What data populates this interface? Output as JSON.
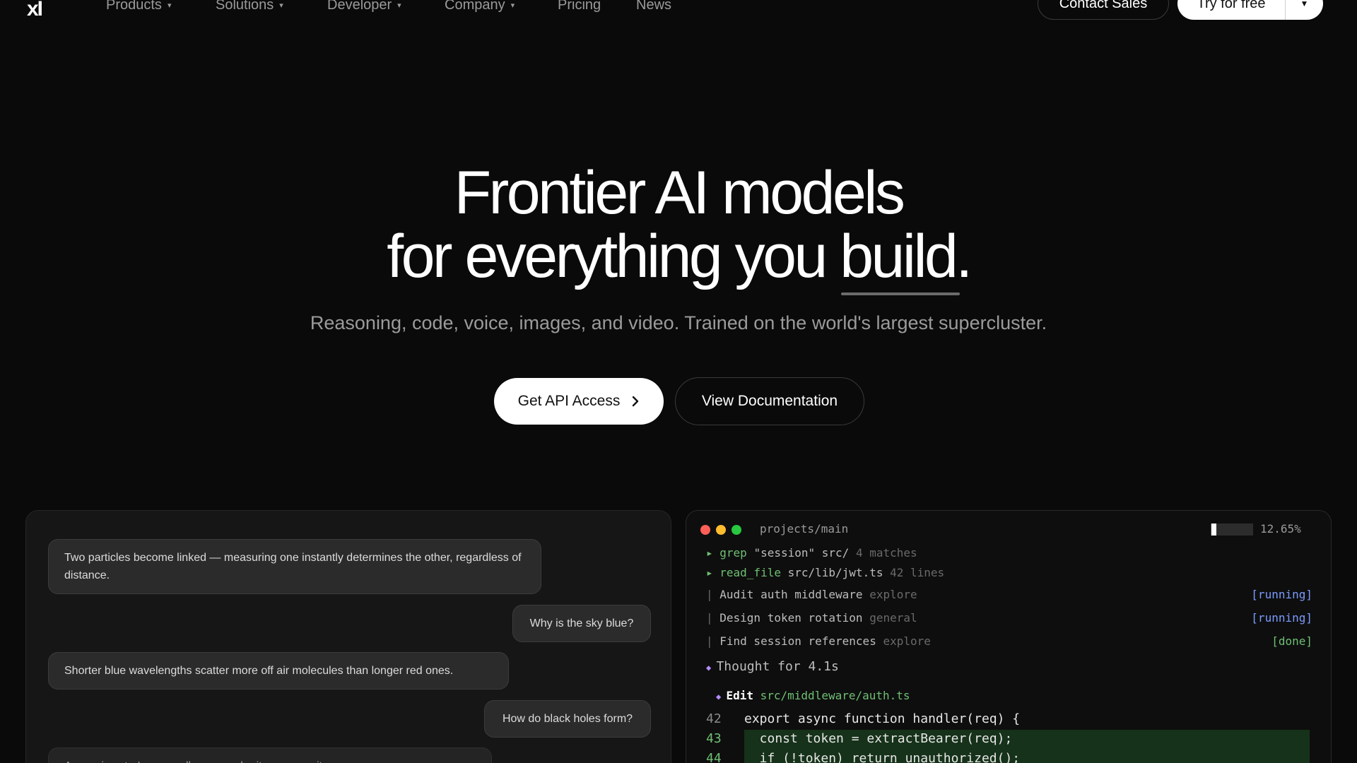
{
  "nav": {
    "logo": "xI",
    "items": [
      {
        "label": "Products",
        "has_dropdown": true
      },
      {
        "label": "Solutions",
        "has_dropdown": true
      },
      {
        "label": "Developer",
        "has_dropdown": true
      },
      {
        "label": "Company",
        "has_dropdown": true
      },
      {
        "label": "Pricing",
        "has_dropdown": false
      },
      {
        "label": "News",
        "has_dropdown": false
      }
    ],
    "contact_label": "Contact Sales",
    "try_label": "Try for free"
  },
  "hero": {
    "title_line1": "Frontier AI models",
    "title_line2_prefix": "for everything you ",
    "title_highlight": "build",
    "title_suffix": ".",
    "subtitle": "Reasoning, code, voice, images, and video. Trained on the world's largest supercluster.",
    "cta_primary": "Get API Access",
    "cta_secondary": "View Documentation"
  },
  "chat": {
    "messages": [
      {
        "role": "assistant",
        "text": "Two particles become linked — measuring one instantly determines the other, regardless of distance."
      },
      {
        "role": "user",
        "text": "Why is the sky blue?"
      },
      {
        "role": "assistant",
        "text": "Shorter blue wavelengths scatter more off air molecules than longer red ones."
      },
      {
        "role": "user",
        "text": "How do black holes form?"
      },
      {
        "role": "assistant",
        "text": "A massive star's core collapses under its own gravity."
      }
    ]
  },
  "terminal": {
    "path": "projects/main",
    "progress_pct": 12.65,
    "progress_label": "12.65%",
    "tools": [
      {
        "cmd": "grep",
        "arg": "\"session\" src/",
        "meta": "4 matches"
      },
      {
        "cmd": "read_file",
        "arg": "src/lib/jwt.ts",
        "meta": "42 lines"
      }
    ],
    "tasks": [
      {
        "name": "Audit auth middleware",
        "type": "explore",
        "status": "[running]"
      },
      {
        "name": "Design token rotation",
        "type": "general",
        "status": "[running]"
      },
      {
        "name": "Find session references",
        "type": "explore",
        "status": "[done]"
      }
    ],
    "thought": "Thought for 4.1s",
    "edit_label": "Edit",
    "edit_file": "src/middleware/auth.ts",
    "code": [
      {
        "ln": "42",
        "text": "export async function handler(req) {"
      },
      {
        "ln": "43",
        "text": "  const token = extractBearer(req);"
      },
      {
        "ln": "44",
        "text": "  if (!token) return unauthorized();"
      }
    ]
  },
  "colors": {
    "background": "#0a0a0a",
    "accent_green": "#6fbf73",
    "accent_blue": "#7b9cff",
    "accent_purple": "#b58cff"
  }
}
